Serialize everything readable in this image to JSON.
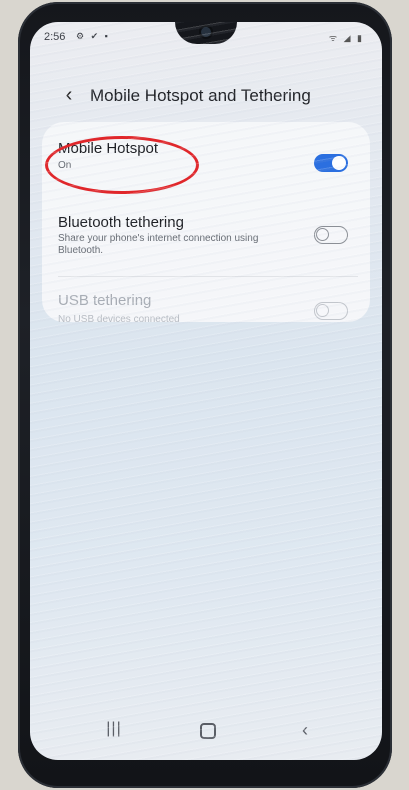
{
  "status_bar": {
    "time": "2:56",
    "notification_icons": [
      "settings-icon",
      "check-icon",
      "message-icon"
    ],
    "right_icons": [
      "wifi-icon",
      "signal-icon",
      "battery-icon"
    ]
  },
  "header": {
    "title": "Mobile Hotspot and Tethering"
  },
  "settings": [
    {
      "label": "Mobile Hotspot",
      "sub": "On",
      "toggle_on": true,
      "enabled": true
    },
    {
      "label": "Bluetooth tethering",
      "sub": "Share your phone's internet connection using Bluetooth.",
      "toggle_on": false,
      "enabled": true
    },
    {
      "label": "USB tethering",
      "sub": "No USB devices connected",
      "toggle_on": false,
      "enabled": false
    }
  ],
  "colors": {
    "accent": "#2b6fe0",
    "annotation": "#e0262a"
  }
}
